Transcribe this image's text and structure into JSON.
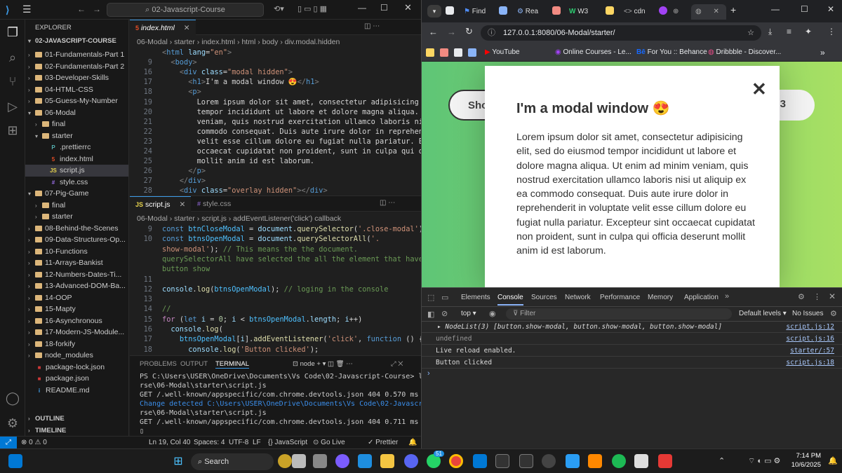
{
  "vscode": {
    "search_text": "02-Javascript-Course",
    "explorer_label": "EXPLORER",
    "root_folder": "02-JAVASCRIPT-COURSE",
    "tree": [
      {
        "label": "01-Fundamentals-Part 1",
        "kind": "folder",
        "open": false,
        "depth": 1
      },
      {
        "label": "02-Fundamentals-Part 2",
        "kind": "folder",
        "open": false,
        "depth": 1
      },
      {
        "label": "03-Developer-Skills",
        "kind": "folder",
        "open": false,
        "depth": 1
      },
      {
        "label": "04-HTML-CSS",
        "kind": "folder",
        "open": false,
        "depth": 1
      },
      {
        "label": "05-Guess-My-Number",
        "kind": "folder",
        "open": false,
        "depth": 1
      },
      {
        "label": "06-Modal",
        "kind": "folder",
        "open": true,
        "depth": 1
      },
      {
        "label": "final",
        "kind": "folder",
        "open": false,
        "depth": 2
      },
      {
        "label": "starter",
        "kind": "folder",
        "open": true,
        "depth": 2
      },
      {
        "label": ".prettierrc",
        "kind": "prettier",
        "depth": 3
      },
      {
        "label": "index.html",
        "kind": "html",
        "depth": 3
      },
      {
        "label": "script.js",
        "kind": "js",
        "depth": 3,
        "selected": true
      },
      {
        "label": "style.css",
        "kind": "css",
        "depth": 3
      },
      {
        "label": "07-Pig-Game",
        "kind": "folder",
        "open": true,
        "depth": 1
      },
      {
        "label": "final",
        "kind": "folder",
        "open": false,
        "depth": 2
      },
      {
        "label": "starter",
        "kind": "folder",
        "open": false,
        "depth": 2
      },
      {
        "label": "08-Behind-the-Scenes",
        "kind": "folder",
        "open": false,
        "depth": 1
      },
      {
        "label": "09-Data-Structures-Op...",
        "kind": "folder",
        "open": false,
        "depth": 1
      },
      {
        "label": "10-Functions",
        "kind": "folder",
        "open": false,
        "depth": 1
      },
      {
        "label": "11-Arrays-Bankist",
        "kind": "folder",
        "open": false,
        "depth": 1
      },
      {
        "label": "12-Numbers-Dates-Ti...",
        "kind": "folder",
        "open": false,
        "depth": 1
      },
      {
        "label": "13-Advanced-DOM-Ba...",
        "kind": "folder",
        "open": false,
        "depth": 1
      },
      {
        "label": "14-OOP",
        "kind": "folder",
        "open": false,
        "depth": 1
      },
      {
        "label": "15-Mapty",
        "kind": "folder",
        "open": false,
        "depth": 1
      },
      {
        "label": "16-Asynchronous",
        "kind": "folder",
        "open": false,
        "depth": 1
      },
      {
        "label": "17-Modern-JS-Module...",
        "kind": "folder",
        "open": false,
        "depth": 1
      },
      {
        "label": "18-forkify",
        "kind": "folder",
        "open": false,
        "depth": 1
      },
      {
        "label": "node_modules",
        "kind": "folder",
        "open": false,
        "depth": 1
      },
      {
        "label": "package-lock.json",
        "kind": "npm",
        "depth": 1
      },
      {
        "label": "package.json",
        "kind": "npm",
        "depth": 1
      },
      {
        "label": "README.md",
        "kind": "md",
        "depth": 1
      }
    ],
    "outline_label": "OUTLINE",
    "timeline_label": "TIMELINE",
    "editor1": {
      "tab": "index.html",
      "breadcrumb": [
        "06-Modal",
        "starter",
        "index.html",
        "html",
        "body",
        "div.modal.hidden"
      ],
      "lines": [
        {
          "n": "",
          "html": "<span class='t'>&lt;</span><span class='tn'>html</span> <span class='at'>lang</span><span class='w'>=</span><span class='s'>\"en\"</span><span class='t'>&gt;</span>"
        },
        {
          "n": "9",
          "html": "  <span class='t'>&lt;</span><span class='tn'>body</span><span class='t'>&gt;</span>"
        },
        {
          "n": "16",
          "html": "    <span class='t'>&lt;</span><span class='tn'>div</span> <span class='at'>class</span><span class='w'>=</span><span class='s'>\"modal hidden\"</span><span class='t'>&gt;</span>"
        },
        {
          "n": "17",
          "html": "      <span class='t'>&lt;</span><span class='tn'>h1</span><span class='t'>&gt;</span><span class='w'>I'm a modal window 😍</span><span class='t'>&lt;/</span><span class='tn'>h1</span><span class='t'>&gt;</span>"
        },
        {
          "n": "18",
          "html": "      <span class='t'>&lt;</span><span class='tn'>p</span><span class='t'>&gt;</span>"
        },
        {
          "n": "19",
          "html": "        <span class='w'>Lorem ipsum dolor sit amet, consectetur adipisicing eli</span>"
        },
        {
          "n": "20",
          "html": "        <span class='w'>tempor incididunt ut labore et dolore magna aliqua. Ut</span>"
        },
        {
          "n": "21",
          "html": "        <span class='w'>veniam, quis nostrud exercitation ullamco laboris nisi</span>"
        },
        {
          "n": "22",
          "html": "        <span class='w'>commodo consequat. Duis aute irure dolor in reprehender</span>"
        },
        {
          "n": "23",
          "html": "        <span class='w'>velit esse cillum dolore eu fugiat nulla pariatur. Exce</span>"
        },
        {
          "n": "24",
          "html": "        <span class='w'>occaecat cupidatat non proident, sunt in culpa qui offi</span>"
        },
        {
          "n": "25",
          "html": "        <span class='w'>mollit anim id est laborum.</span>"
        },
        {
          "n": "26",
          "html": "      <span class='t'>&lt;/</span><span class='tn'>p</span><span class='t'>&gt;</span>"
        },
        {
          "n": "27",
          "html": "    <span class='t'>&lt;/</span><span class='tn'>div</span><span class='t'>&gt;</span>"
        },
        {
          "n": "28",
          "html": "    <span class='t'>&lt;</span><span class='tn'>div</span> <span class='at'>class</span><span class='w'>=</span><span class='s'>\"overlay hidden\"</span><span class='t'>&gt;&lt;/</span><span class='tn'>div</span><span class='t'>&gt;</span>"
        }
      ]
    },
    "editor2": {
      "tab_active": "script.js",
      "tab_other": "style.css",
      "breadcrumb": [
        "06-Modal",
        "starter",
        "script.js",
        "addEventListener('click') callback"
      ],
      "lines": [
        {
          "n": "9",
          "html": "<span class='k'>const</span> <span class='p'>btnCloseModal</span> <span class='w'>=</span> <span class='v'>document</span><span class='w'>.</span><span class='f'>querySelector</span><span class='w'>(</span><span class='s'>'.close-modal'</span><span class='w'>);</span>"
        },
        {
          "n": "10",
          "html": "<span class='k'>const</span> <span class='p'>btnsOpenModal</span> <span class='w'>=</span> <span class='v'>document</span><span class='w'>.</span><span class='f'>querySelectorAll</span><span class='w'>(</span><span class='s'>'.</span>"
        },
        {
          "n": "",
          "html": "<span class='s'>show-modal'</span><span class='w'>);</span> <span class='c'>// This means the the document.</span>"
        },
        {
          "n": "",
          "html": "<span class='c'>querySelectorAll have selected the all the element that have</span>"
        },
        {
          "n": "",
          "html": "<span class='c'>button show</span>"
        },
        {
          "n": "11",
          "html": ""
        },
        {
          "n": "12",
          "html": "<span class='v'>console</span><span class='w'>.</span><span class='f'>log</span><span class='w'>(</span><span class='p'>btnsOpenModal</span><span class='w'>);</span> <span class='c'>// loging in the console</span>"
        },
        {
          "n": "13",
          "html": ""
        },
        {
          "n": "14",
          "html": "<span class='c'>//</span>"
        },
        {
          "n": "15",
          "html": "<span class='kw'>for</span> <span class='w'>(</span><span class='k'>let</span> <span class='v'>i</span> <span class='w'>=</span> <span class='n'>0</span><span class='w'>; </span><span class='v'>i</span> <span class='w'>&lt;</span> <span class='p'>btnsOpenModal</span><span class='w'>.</span><span class='v'>length</span><span class='w'>; </span><span class='v'>i</span><span class='w'>++)</span>"
        },
        {
          "n": "16",
          "html": "  <span class='v'>console</span><span class='w'>.</span><span class='f'>log</span><span class='w'>(</span>"
        },
        {
          "n": "17",
          "html": "    <span class='p'>btnsOpenModal</span><span class='w'>[</span><span class='v'>i</span><span class='w'>].</span><span class='f'>addEventListener</span><span class='w'>(</span><span class='s'>'click'</span><span class='w'>, </span><span class='k'>function</span> <span class='w'>() {</span>"
        },
        {
          "n": "18",
          "html": "      <span class='v'>console</span><span class='w'>.</span><span class='f'>log</span><span class='w'>(</span><span class='s'>'Button clicked'</span><span class='w'>);</span>"
        }
      ]
    },
    "terminal": {
      "tabs": [
        "PROBLEMS",
        "OUTPUT",
        "TERMINAL"
      ],
      "shell": "node",
      "lines": [
        "PS C:\\Users\\USER\\OneDrive\\Documents\\Vs Code\\02-Javascript-Course> live-ser",
        "rse\\06-Modal\\starter\\script.js",
        "GET /.well-known/appspecific/com.chrome.devtools.json 404 0.570 ms - 187",
        "Change detected C:\\Users\\USER\\OneDrive\\Documents\\Vs Code\\02-Javascript-Cou",
        "rse\\06-Modal\\starter\\script.js",
        "GET /.well-known/appspecific/com.chrome.devtools.json 404 0.711 ms - 187"
      ]
    },
    "status": {
      "errors": "⊗ 0 ⚠ 0",
      "position": "Ln 19, Col 40",
      "spaces": "Spaces: 4",
      "encoding": "UTF-8",
      "eol": "LF",
      "language": "{} JavaScript",
      "golive": "Go Live",
      "prettier": "✓ Prettier"
    }
  },
  "chrome": {
    "tabs": [
      "Find",
      "Rea",
      "W3",
      "cdn"
    ],
    "url": "127.0.0.1:8080/06-Modal/starter/",
    "bookmarks": [
      "YouTube",
      "Online Courses - Le...",
      "For You :: Behance",
      "Dribbble - Discover..."
    ],
    "page": {
      "button_left": "Sho",
      "button_right": "al 3",
      "modal_title": "I'm a modal window 😍",
      "modal_text": "Lorem ipsum dolor sit amet, consectetur adipisicing elit, sed do eiusmod tempor incididunt ut labore et dolore magna aliqua. Ut enim ad minim veniam, quis nostrud exercitation ullamco laboris nisi ut aliquip ex ea commodo consequat. Duis aute irure dolor in reprehenderit in voluptate velit esse cillum dolore eu fugiat nulla pariatur. Excepteur sint occaecat cupidatat non proident, sunt in culpa qui officia deserunt mollit anim id est laborum.",
      "close": "✕"
    },
    "devtools": {
      "tabs": [
        "Elements",
        "Console",
        "Sources",
        "Network",
        "Performance",
        "Memory",
        "Application"
      ],
      "active": "Console",
      "context": "top",
      "filter_placeholder": "Filter",
      "levels": "Default levels",
      "issues": "No Issues",
      "logs": [
        {
          "text": "▸ NodeList(3) [button.show-modal, button.show-modal, button.show-modal]",
          "src": "script.js:12"
        },
        {
          "text": "undefined",
          "src": "script.js:16"
        },
        {
          "text": "Live reload enabled.",
          "src": "starter/:57"
        },
        {
          "text": "Button clicked",
          "src": "script.js:18"
        }
      ]
    }
  },
  "taskbar": {
    "search": "Search",
    "time": "7:14 PM",
    "date": "10/6/2025",
    "badge": "51"
  }
}
